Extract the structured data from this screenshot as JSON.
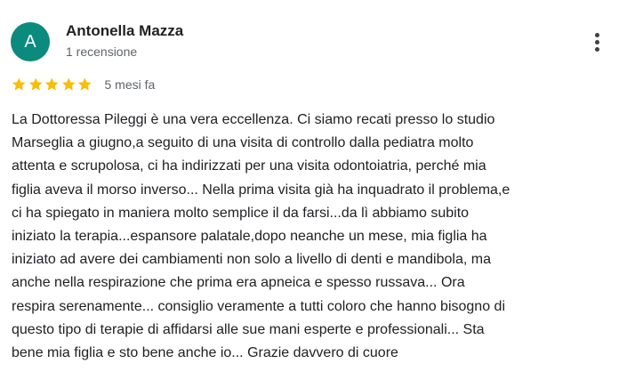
{
  "review": {
    "avatar_letter": "A",
    "avatar_color": "#0b8a7e",
    "author_name": "Antonella Mazza",
    "review_count": "1 recensione",
    "rating": 5,
    "star_color": "#fbbc04",
    "date": "5 mesi fa",
    "menu_icon": "more-vertical-icon",
    "text_lines": [
      "La Dottoressa Pileggi è una vera eccellenza. Ci siamo recati presso lo studio",
      "Marseglia a giugno,a seguito di una visita di controllo dalla pediatra molto",
      "attenta e scrupolosa, ci ha indirizzati per una visita odontoiatria, perché mia",
      "figlia aveva il morso inverso... Nella prima visita già ha inquadrato il problema,e",
      "ci ha spiegato in maniera molto semplice il da farsi...da lì abbiamo subito",
      "iniziato la terapia...espansore palatale,dopo neanche un mese, mia figlia ha",
      "iniziato ad avere dei cambiamenti non solo a livello di denti e mandibola, ma",
      "anche nella respirazione che prima era apneica e spesso russava... Ora",
      "respira serenamente... consiglio veramente a tutti coloro che hanno bisogno di",
      "questo tipo di terapie di affidarsi alle sue mani esperte e professionali... Sta",
      "bene mia figlia e sto bene anche io... Grazie davvero di cuore"
    ]
  }
}
